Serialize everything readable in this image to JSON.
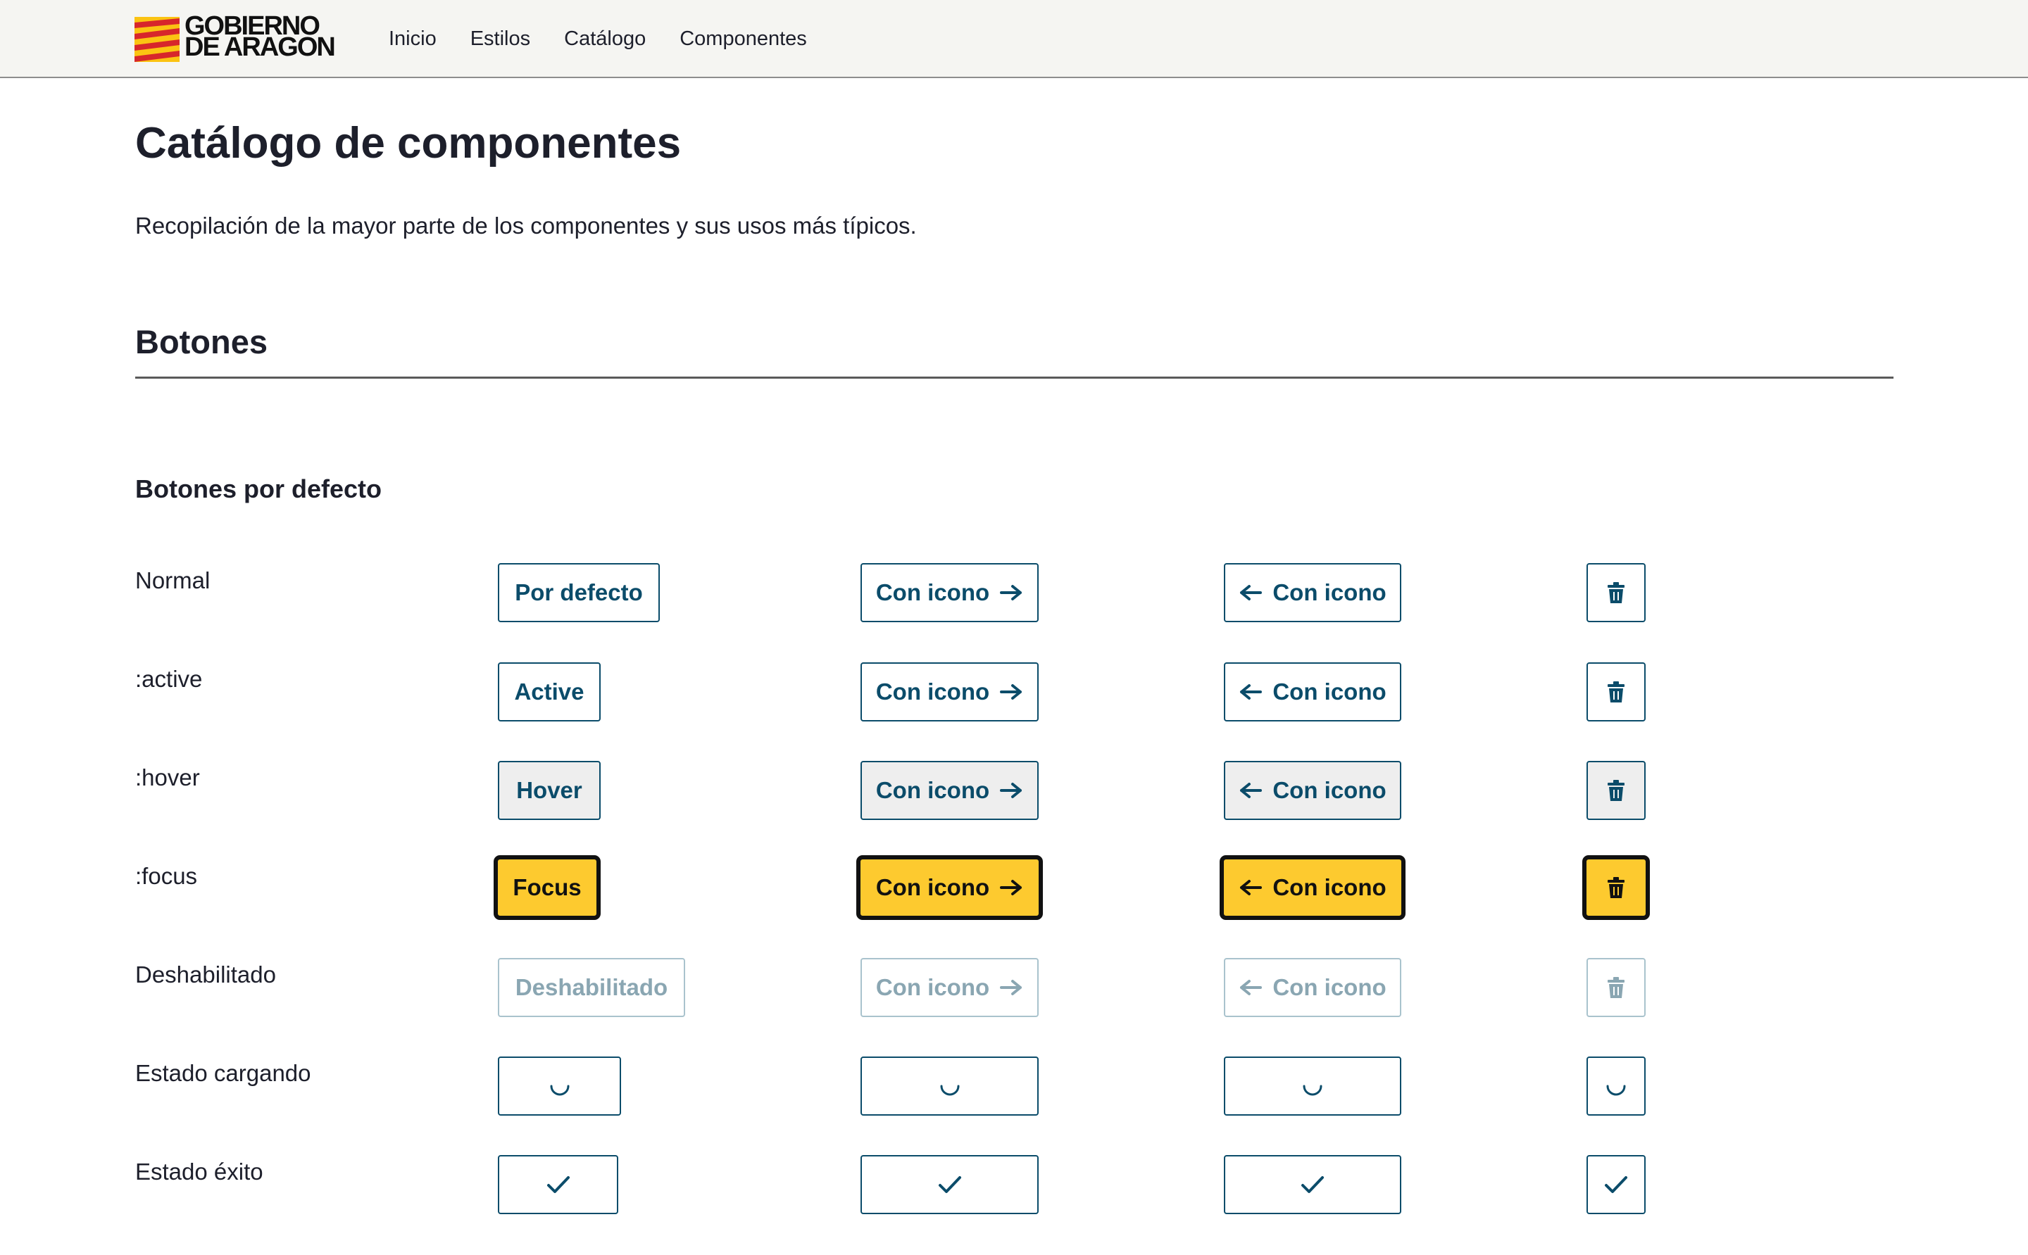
{
  "header": {
    "logo_line1": "GOBIERNO",
    "logo_line2": "DE ARAGON",
    "nav": [
      {
        "label": "Inicio"
      },
      {
        "label": "Estilos"
      },
      {
        "label": "Catálogo"
      },
      {
        "label": "Componentes"
      }
    ]
  },
  "page": {
    "title": "Catálogo de componentes",
    "intro": "Recopilación de la mayor parte de los componentes y sus usos más típicos."
  },
  "section": {
    "title": "Botones",
    "subsection": "Botones por defecto"
  },
  "rows": [
    {
      "label": "Normal",
      "button_text": "Por defecto",
      "icon_text": "Con icono"
    },
    {
      "label": ":active",
      "button_text": "Active",
      "icon_text": "Con icono"
    },
    {
      "label": ":hover",
      "button_text": "Hover",
      "icon_text": "Con icono"
    },
    {
      "label": ":focus",
      "button_text": "Focus",
      "icon_text": "Con icono"
    },
    {
      "label": "Deshabilitado",
      "button_text": "Deshabilitado",
      "icon_text": "Con icono"
    },
    {
      "label": "Estado cargando"
    },
    {
      "label": "Estado éxito"
    }
  ],
  "colors": {
    "primary": "#0b4c6a",
    "focus_bg": "#fdca2f",
    "focus_border": "#111111",
    "hover_bg": "#eeeeee",
    "disabled": "#8aa6b2",
    "header_bg": "#f5f5f2"
  },
  "icons": {
    "arrow_right": "arrow-right-icon",
    "arrow_left": "arrow-left-icon",
    "trash": "trash-icon",
    "spinner": "spinner-icon",
    "check": "check-icon"
  }
}
